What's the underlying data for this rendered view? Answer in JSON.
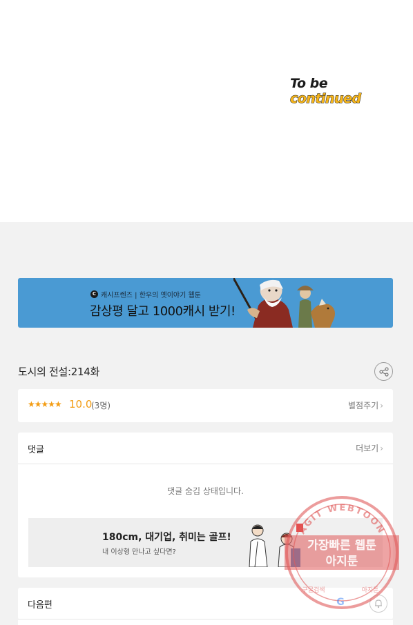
{
  "comic": {
    "end_text_part1": "To be ",
    "end_text_part2": "continued"
  },
  "banner": {
    "logo_letter": "C",
    "subtitle": "캐시프렌즈 | 한우의 옛이야기 웹툰",
    "headline": "감상평 달고 1000캐시 받기!",
    "color": "#4a9ad3"
  },
  "episode": {
    "title": "도시의 전설:214화",
    "share_icon": "share-icon"
  },
  "rating": {
    "stars": "★★★★★",
    "score": "10.0",
    "count": "(3명)",
    "rate_link": "별점주기",
    "star_color": "#f39c12"
  },
  "comments": {
    "title": "댓글",
    "more_link": "더보기",
    "hidden_message": "댓글 숨김 상태입니다."
  },
  "ad": {
    "headline": "180cm, 대기업, 취미는 골프!",
    "subline": "내 이상형 만나고 싶다면?"
  },
  "next_episode": {
    "title": "다음편",
    "bell_icon": "bell-icon"
  },
  "watermark": {
    "ring_text": "AGIT WEBTOON",
    "line1": "가장빠른 웹툰",
    "line2": "아지툰",
    "bottom_left": "구글검색",
    "bottom_right": "아지툰",
    "google_letter": "G",
    "color": "#e05a5a"
  },
  "chevron": "›"
}
